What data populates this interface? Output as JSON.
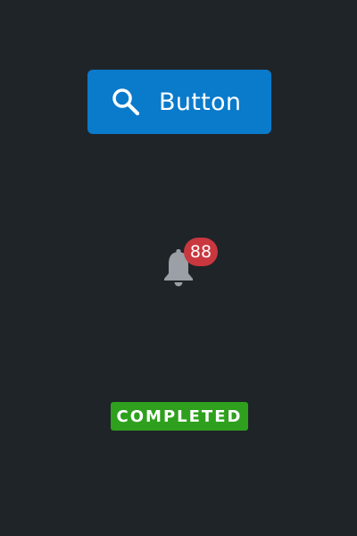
{
  "button": {
    "label": "Button",
    "icon": "search-icon",
    "background_color": "#0a7acb",
    "text_color": "#ffffff"
  },
  "notifications": {
    "icon": "bell-icon",
    "count": "88",
    "badge_color": "#c9373f",
    "icon_color": "#9aa0a6"
  },
  "status": {
    "label": "COMPLETED",
    "color": "#2ea01d"
  },
  "theme": {
    "background": "#1f2428"
  }
}
